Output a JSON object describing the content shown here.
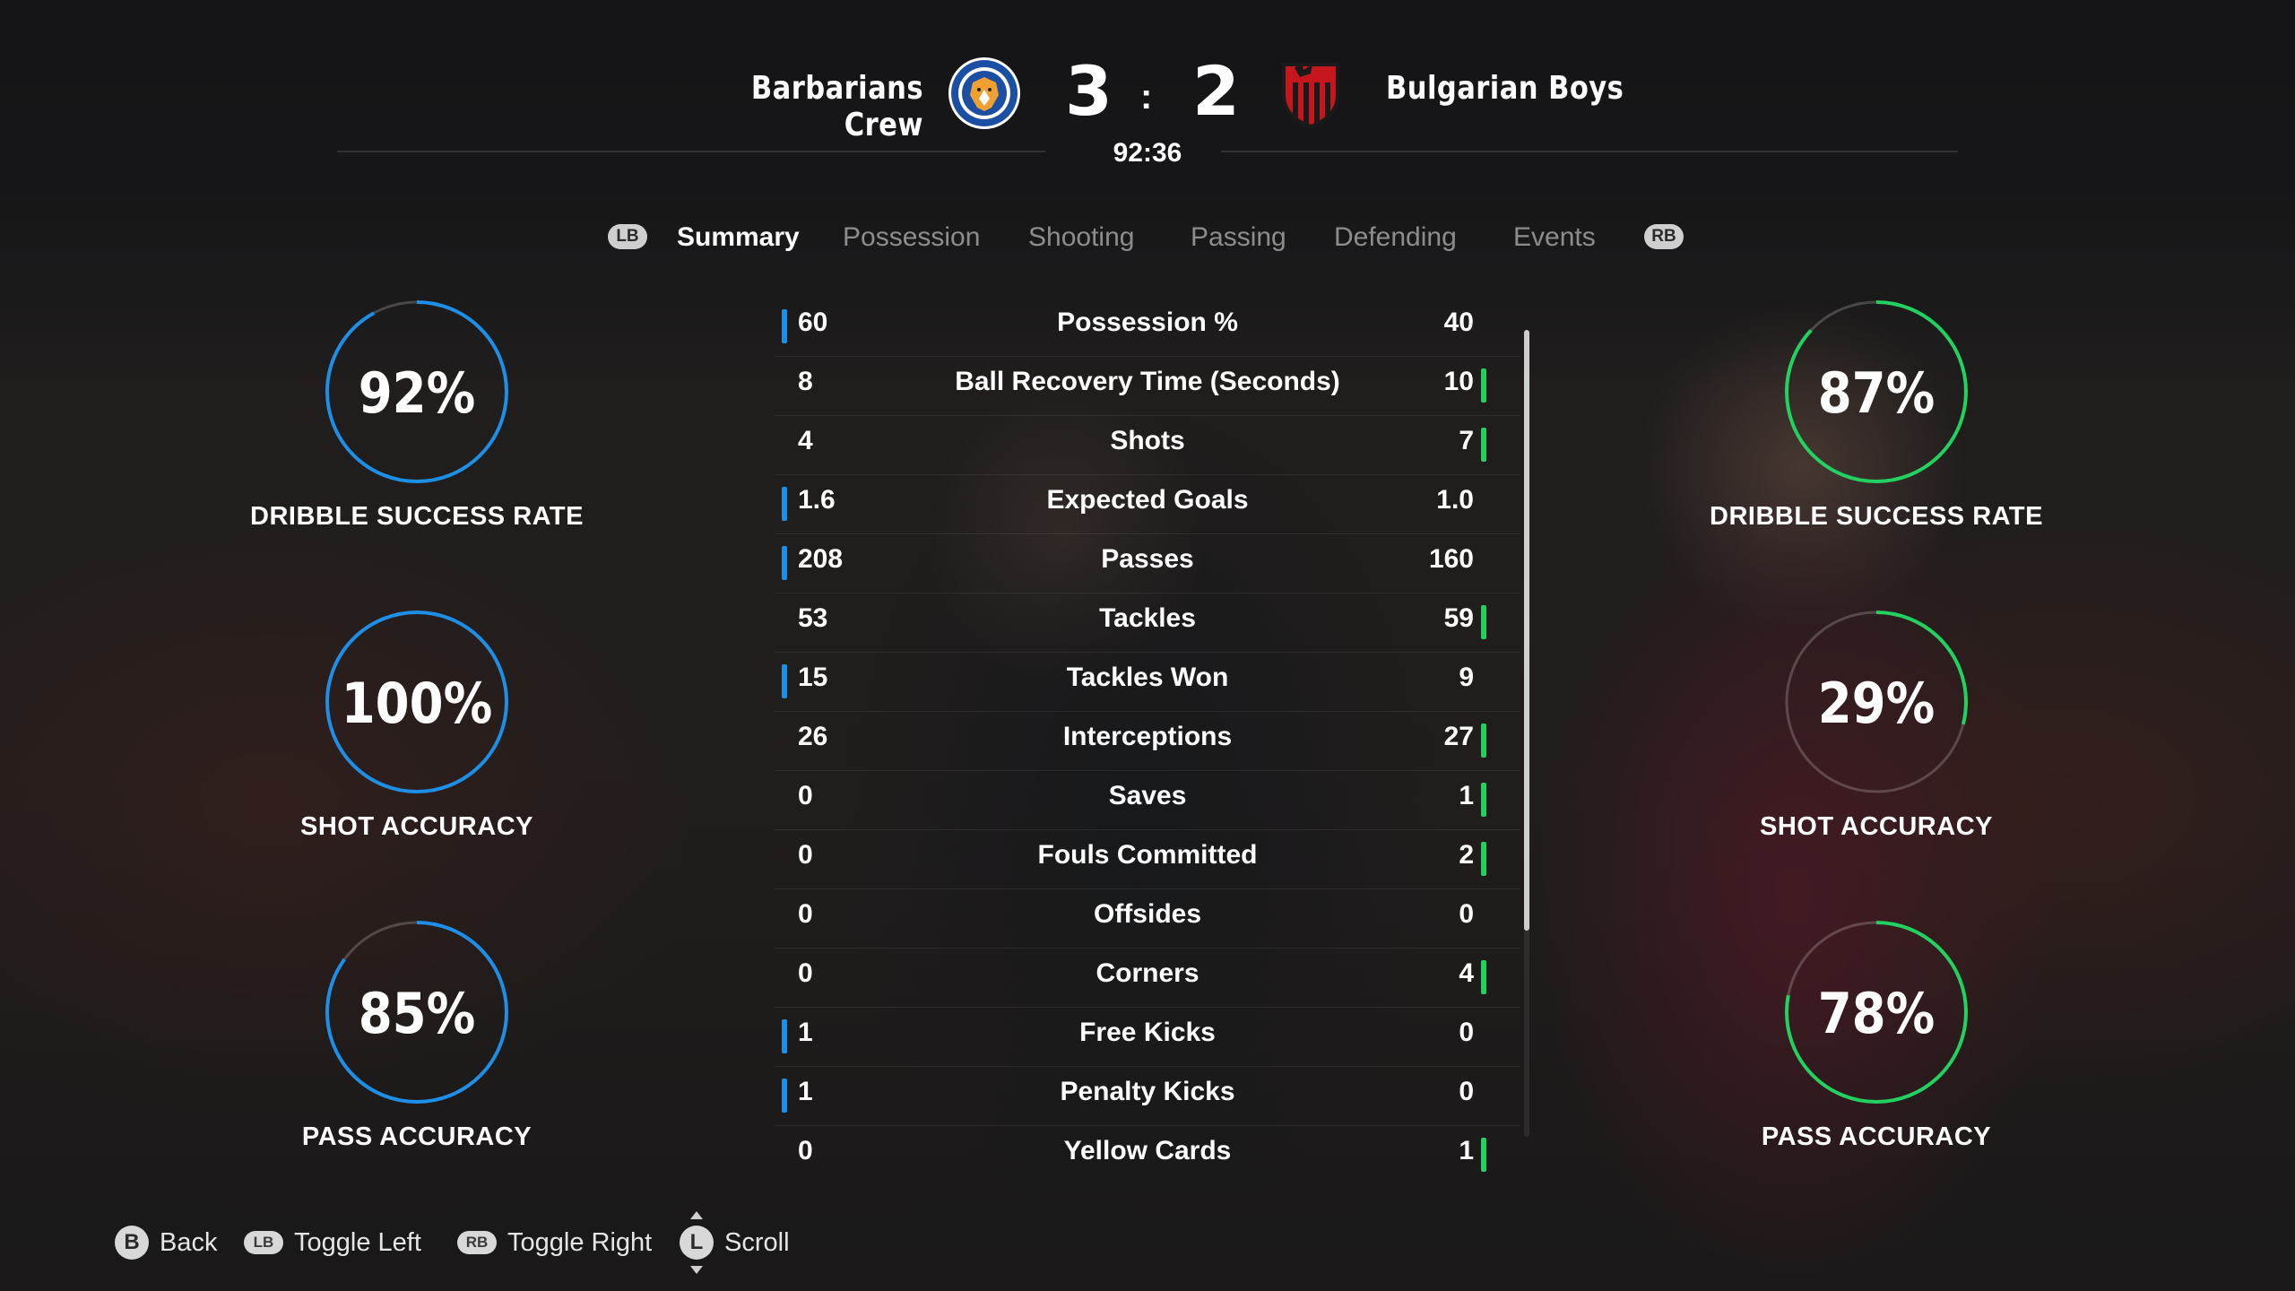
{
  "header": {
    "home_team": "Barbarians Crew",
    "away_team": "Bulgarian Boys",
    "home_score": "3",
    "away_score": "2",
    "separator": ":",
    "match_clock": "92:36"
  },
  "tabs": {
    "left_button": "LB",
    "right_button": "RB",
    "items": [
      "Summary",
      "Possession",
      "Shooting",
      "Passing",
      "Defending",
      "Events"
    ],
    "active": "Summary"
  },
  "home_rings": [
    {
      "value": "92%",
      "percent": 92,
      "label": "DRIBBLE SUCCESS RATE"
    },
    {
      "value": "100%",
      "percent": 100,
      "label": "SHOT ACCURACY"
    },
    {
      "value": "85%",
      "percent": 85,
      "label": "PASS ACCURACY"
    }
  ],
  "away_rings": [
    {
      "value": "87%",
      "percent": 87,
      "label": "DRIBBLE SUCCESS RATE"
    },
    {
      "value": "29%",
      "percent": 29,
      "label": "SHOT ACCURACY"
    },
    {
      "value": "78%",
      "percent": 78,
      "label": "PASS ACCURACY"
    }
  ],
  "stats": [
    {
      "name": "Possession %",
      "home": "60",
      "away": "40",
      "home_bar": true,
      "away_bar": false
    },
    {
      "name": "Ball Recovery Time (Seconds)",
      "home": "8",
      "away": "10",
      "home_bar": false,
      "away_bar": true
    },
    {
      "name": "Shots",
      "home": "4",
      "away": "7",
      "home_bar": false,
      "away_bar": true
    },
    {
      "name": "Expected Goals",
      "home": "1.6",
      "away": "1.0",
      "home_bar": true,
      "away_bar": false
    },
    {
      "name": "Passes",
      "home": "208",
      "away": "160",
      "home_bar": true,
      "away_bar": false
    },
    {
      "name": "Tackles",
      "home": "53",
      "away": "59",
      "home_bar": false,
      "away_bar": true
    },
    {
      "name": "Tackles Won",
      "home": "15",
      "away": "9",
      "home_bar": true,
      "away_bar": false
    },
    {
      "name": "Interceptions",
      "home": "26",
      "away": "27",
      "home_bar": false,
      "away_bar": true
    },
    {
      "name": "Saves",
      "home": "0",
      "away": "1",
      "home_bar": false,
      "away_bar": true
    },
    {
      "name": "Fouls Committed",
      "home": "0",
      "away": "2",
      "home_bar": false,
      "away_bar": true
    },
    {
      "name": "Offsides",
      "home": "0",
      "away": "0",
      "home_bar": false,
      "away_bar": false
    },
    {
      "name": "Corners",
      "home": "0",
      "away": "4",
      "home_bar": false,
      "away_bar": true
    },
    {
      "name": "Free Kicks",
      "home": "1",
      "away": "0",
      "home_bar": true,
      "away_bar": false
    },
    {
      "name": "Penalty Kicks",
      "home": "1",
      "away": "0",
      "home_bar": true,
      "away_bar": false
    },
    {
      "name": "Yellow Cards",
      "home": "0",
      "away": "1",
      "home_bar": false,
      "away_bar": true
    }
  ],
  "footer": {
    "back_key": "B",
    "back_label": "Back",
    "toggle_left_key": "LB",
    "toggle_left_label": "Toggle Left",
    "toggle_right_key": "RB",
    "toggle_right_label": "Toggle Right",
    "scroll_key": "L",
    "scroll_label": "Scroll"
  },
  "colors": {
    "home_accent": "#1e8fe6",
    "away_accent": "#22d160",
    "home_crest": "#1b4fa3",
    "away_crest": "#c4161c"
  },
  "icons": {
    "home_crest": "fox-crest-icon",
    "away_crest": "devil-shield-crest-icon"
  }
}
